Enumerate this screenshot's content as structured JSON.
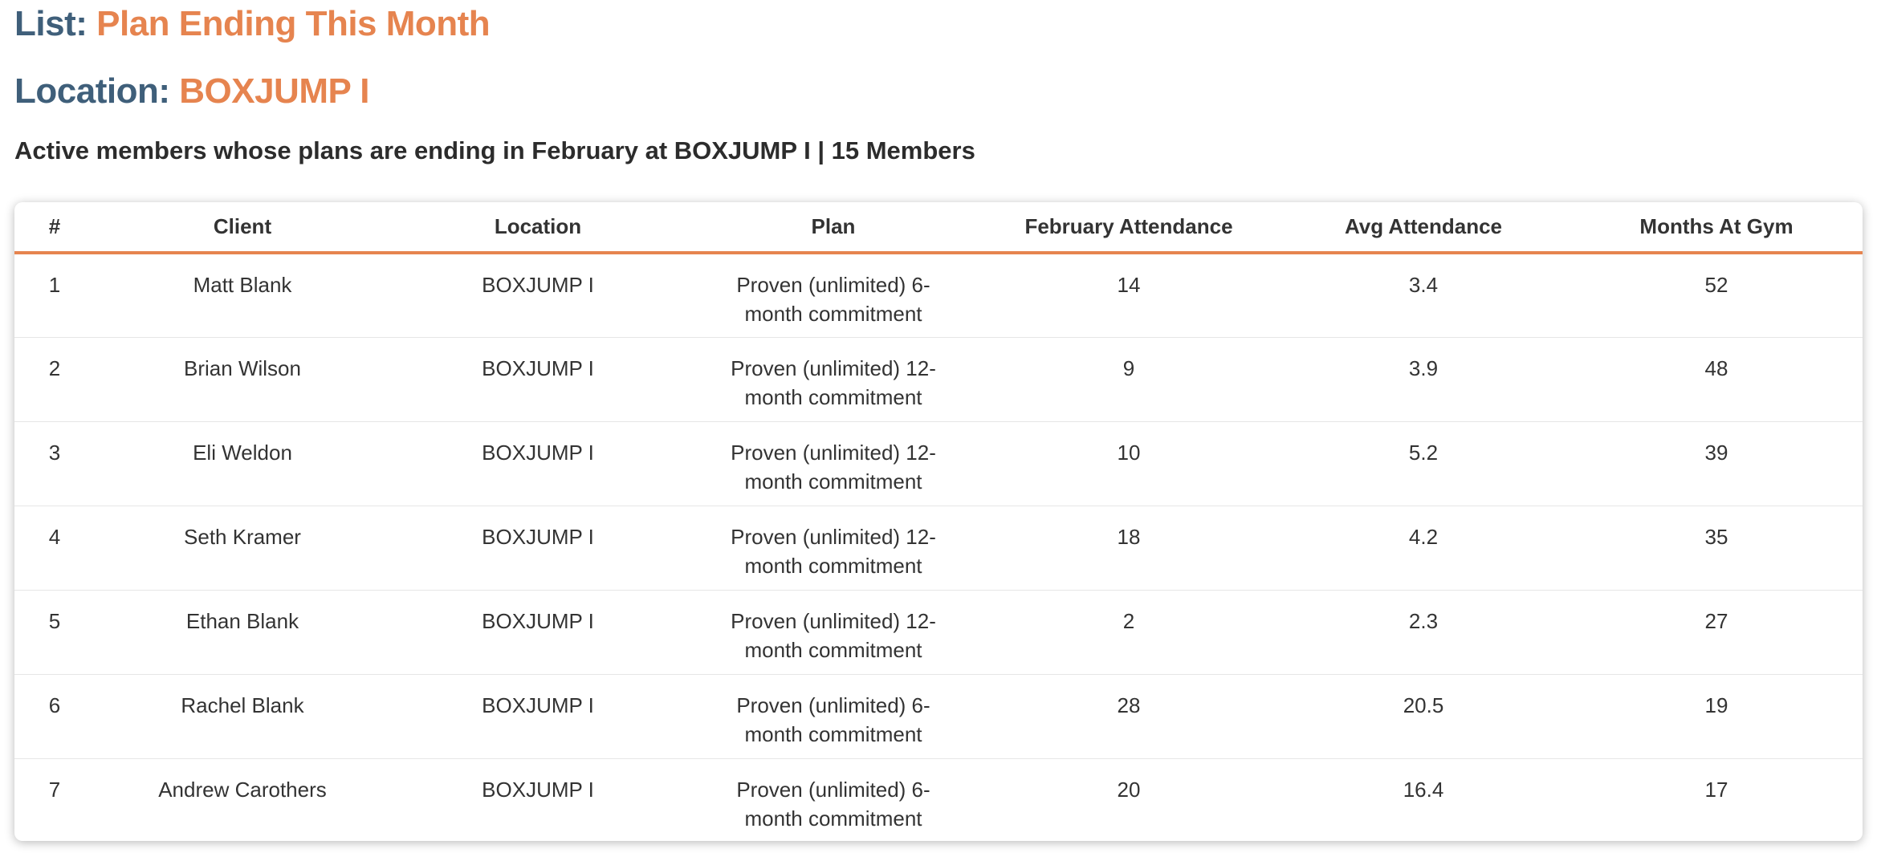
{
  "list": {
    "key": "List:",
    "value": "Plan Ending This Month"
  },
  "location": {
    "key": "Location:",
    "value": "BOXJUMP I"
  },
  "subtitle": "Active members whose plans are ending in February at BOXJUMP I | 15 Members",
  "colors": {
    "heading_key": "#3f5f7a",
    "accent": "#e6844f",
    "text": "#333333"
  },
  "table": {
    "headers": [
      "#",
      "Client",
      "Location",
      "Plan",
      "February Attendance",
      "Avg Attendance",
      "Months At Gym"
    ],
    "rows": [
      [
        "1",
        "Matt Blank",
        "BOXJUMP I",
        "Proven (unlimited) 6-month commitment",
        "14",
        "3.4",
        "52"
      ],
      [
        "2",
        "Brian Wilson",
        "BOXJUMP I",
        "Proven (unlimited) 12-month commitment",
        "9",
        "3.9",
        "48"
      ],
      [
        "3",
        "Eli Weldon",
        "BOXJUMP I",
        "Proven (unlimited) 12-month commitment",
        "10",
        "5.2",
        "39"
      ],
      [
        "4",
        "Seth Kramer",
        "BOXJUMP I",
        "Proven (unlimited) 12-month commitment",
        "18",
        "4.2",
        "35"
      ],
      [
        "5",
        "Ethan Blank",
        "BOXJUMP I",
        "Proven (unlimited) 12-month commitment",
        "2",
        "2.3",
        "27"
      ],
      [
        "6",
        "Rachel Blank",
        "BOXJUMP I",
        "Proven (unlimited) 6-month commitment",
        "28",
        "20.5",
        "19"
      ],
      [
        "7",
        "Andrew Carothers",
        "BOXJUMP I",
        "Proven (unlimited) 6-month commitment",
        "20",
        "16.4",
        "17"
      ]
    ]
  }
}
